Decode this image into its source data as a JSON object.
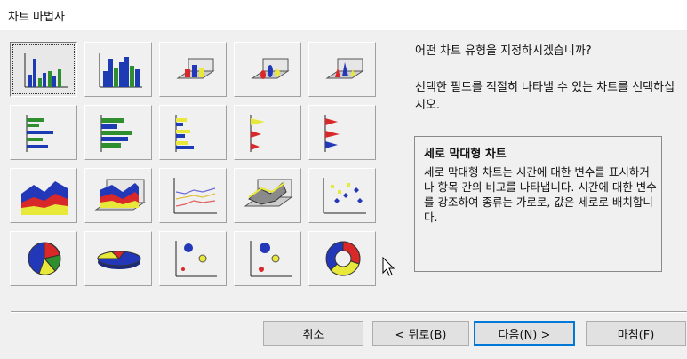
{
  "window": {
    "title": "차트 마법사"
  },
  "question": "어떤 차트 유형을 지정하시겠습니까?",
  "instruction": "선택한 필드를 적절히 나타낼 수 있는 차트를 선택하십시오.",
  "description": {
    "title": "세로 막대형 차트",
    "text": "세로 막대형 차트는 시간에 대한 변수를 표시하거나 항목 간의 비교를 나타냅니다. 시간에 대한 변수를 강조하여 종류는 가로로, 값은 세로로 배치합니다."
  },
  "chart_types": [
    "column-2d",
    "column-stacked",
    "column-3d-a",
    "column-3d-b",
    "column-3d-c",
    "bar-2d",
    "bar-stacked",
    "bar-cluster",
    "bar-cone-a",
    "bar-cone-b",
    "area-2d",
    "area-3d",
    "line-2d",
    "surface-3d",
    "scatter",
    "pie-2d",
    "pie-3d",
    "bubble-a",
    "bubble-b",
    "doughnut"
  ],
  "selected_index": 0,
  "buttons": {
    "cancel": "취소",
    "back": "< 뒤로(B)",
    "next": "다음(N) >",
    "finish": "마침(F)"
  },
  "colors": {
    "yellow": "#e8e83a",
    "green": "#2f8f2f",
    "blue": "#2238b8",
    "red": "#d8282a",
    "default_button_border": "#0078d7"
  }
}
